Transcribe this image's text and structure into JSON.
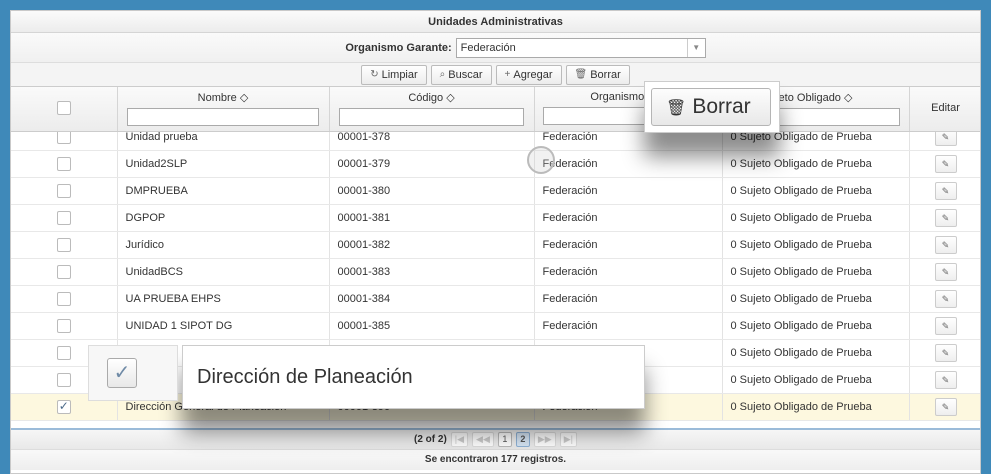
{
  "title": "Unidades Administrativas",
  "organismo": {
    "label": "Organismo Garante:",
    "value": "Federación"
  },
  "toolbar": {
    "limpiar": "Limpiar",
    "buscar": "Buscar",
    "agregar": "Agregar",
    "borrar": "Borrar"
  },
  "columns": {
    "nombre": "Nombre ◇",
    "codigo": "Código ◇",
    "organismo": "Organismo Gar",
    "sujeto": "eto Obligado ◇",
    "editar": "Editar"
  },
  "rows": [
    {
      "nombre": "Unidad  prueba",
      "codigo": "00001-378",
      "organismo": "Federación",
      "sujeto": "0 Sujeto Obligado de Prueba",
      "checked": false
    },
    {
      "nombre": "Unidad2SLP",
      "codigo": "00001-379",
      "organismo": "Federación",
      "sujeto": "0 Sujeto Obligado de Prueba",
      "checked": false
    },
    {
      "nombre": "DMPRUEBA",
      "codigo": "00001-380",
      "organismo": "Federación",
      "sujeto": "0 Sujeto Obligado de Prueba",
      "checked": false
    },
    {
      "nombre": "DGPOP",
      "codigo": "00001-381",
      "organismo": "Federación",
      "sujeto": "0 Sujeto Obligado de Prueba",
      "checked": false
    },
    {
      "nombre": "Jurídico",
      "codigo": "00001-382",
      "organismo": "Federación",
      "sujeto": "0 Sujeto Obligado de Prueba",
      "checked": false
    },
    {
      "nombre": "UnidadBCS",
      "codigo": "00001-383",
      "organismo": "Federación",
      "sujeto": "0 Sujeto Obligado de Prueba",
      "checked": false
    },
    {
      "nombre": "UA PRUEBA EHPS",
      "codigo": "00001-384",
      "organismo": "Federación",
      "sujeto": "0 Sujeto Obligado de Prueba",
      "checked": false
    },
    {
      "nombre": "UNIDAD 1 SIPOT DG",
      "codigo": "00001-385",
      "organismo": "Federación",
      "sujeto": "0 Sujeto Obligado de Prueba",
      "checked": false
    },
    {
      "nombre": "l de",
      "codigo": "",
      "organismo": "",
      "sujeto": "0 Sujeto Obligado de Prueba",
      "checked": false
    },
    {
      "nombre": "ón",
      "codigo": "",
      "organismo": "",
      "sujeto": "0 Sujeto Obligado de Prueba",
      "checked": false
    },
    {
      "nombre": "Dirección General de Planeación",
      "codigo": "00001-390",
      "organismo": "Federación",
      "sujeto": "0 Sujeto Obligado de Prueba",
      "checked": true
    }
  ],
  "pager": {
    "info": "(2 of 2)",
    "pages": [
      "1",
      "2"
    ],
    "first": "|◀",
    "prev": "◀◀",
    "next": "▶▶",
    "last": "▶|"
  },
  "footer": "Se encontraron 177 registros.",
  "zoom": {
    "borrar": "Borrar",
    "direccion": "Dirección de Planeación"
  },
  "icons": {
    "limpiar": "reset-icon",
    "buscar": "search-icon",
    "agregar": "plus-icon",
    "borrar": "trash-icon",
    "editar": "pencil-icon"
  }
}
